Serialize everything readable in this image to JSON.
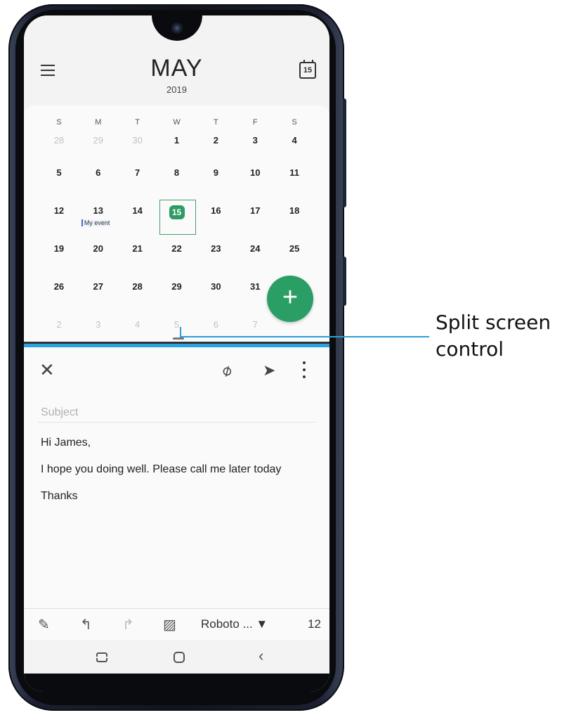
{
  "calendar": {
    "month": "MAY",
    "year": "2019",
    "today_icon": "15",
    "weekdays": [
      "S",
      "M",
      "T",
      "W",
      "T",
      "F",
      "S"
    ],
    "weeks": [
      [
        "28",
        "29",
        "30",
        "1",
        "2",
        "3",
        "4"
      ],
      [
        "5",
        "6",
        "7",
        "8",
        "9",
        "10",
        "11"
      ],
      [
        "12",
        "13",
        "14",
        "15",
        "16",
        "17",
        "18"
      ],
      [
        "19",
        "20",
        "21",
        "22",
        "23",
        "24",
        "25"
      ],
      [
        "26",
        "27",
        "28",
        "29",
        "30",
        "31",
        ""
      ],
      [
        "2",
        "3",
        "4",
        "5",
        "6",
        "7",
        ""
      ]
    ],
    "event_label": "My event",
    "fab_label": "+"
  },
  "email": {
    "subject_placeholder": "Subject",
    "greeting": "Hi James,",
    "message": "I hope you doing well. Please call me later today",
    "signoff": "Thanks"
  },
  "format_bar": {
    "font": "Roboto ... ▼",
    "size": "12"
  },
  "annotation": {
    "line1": "Split screen",
    "line2": "control"
  },
  "colors": {
    "accent_green": "#2a9e64",
    "divider_blue": "#2aa4e0"
  }
}
